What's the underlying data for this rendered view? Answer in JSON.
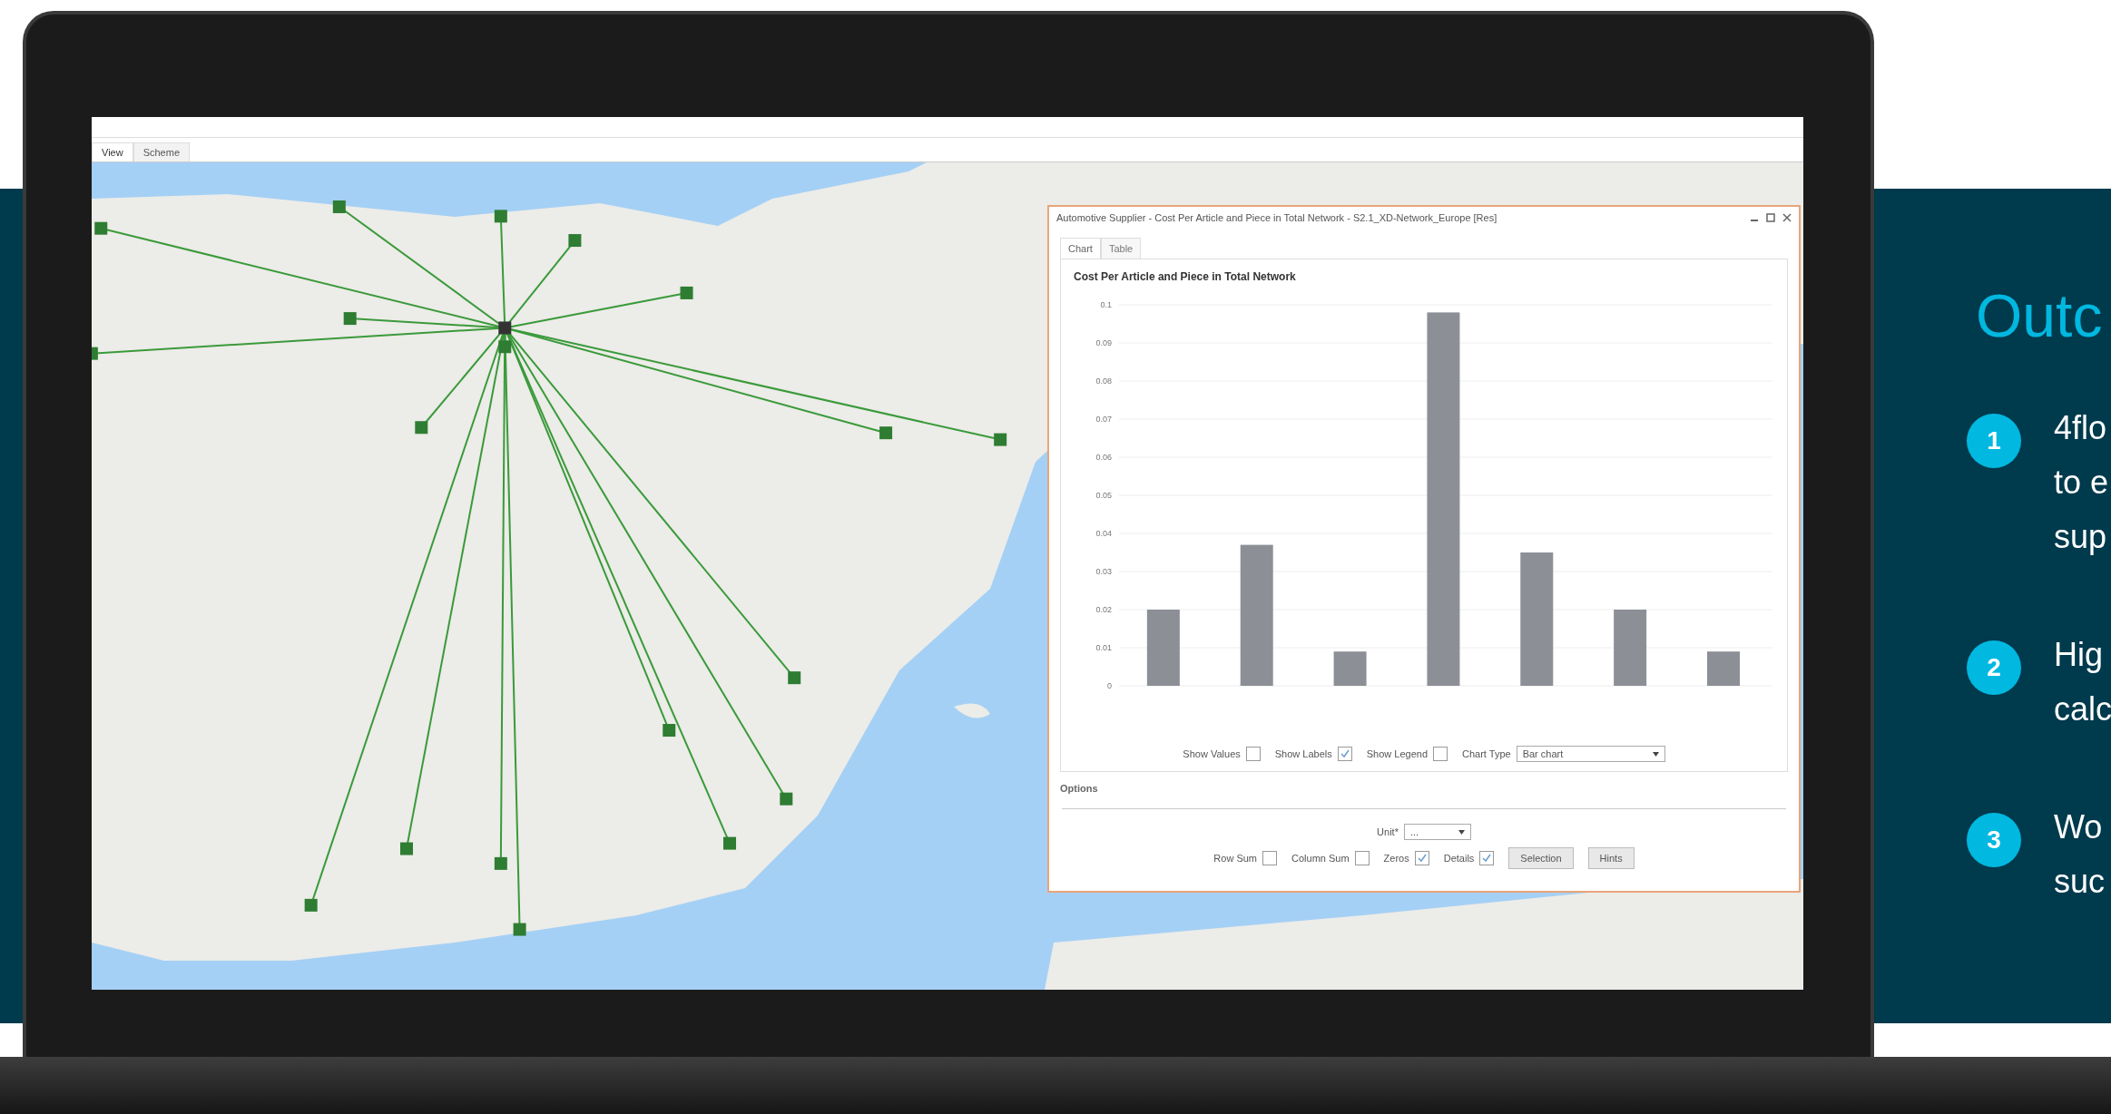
{
  "app": {
    "tabs": [
      {
        "label": "View",
        "selected": true
      },
      {
        "label": "Scheme",
        "selected": false
      }
    ]
  },
  "chart_window": {
    "title": "Automotive Supplier - Cost Per Article and Piece in Total Network - S2.1_XD-Network_Europe [Res]",
    "tabs": [
      {
        "label": "Chart",
        "selected": true
      },
      {
        "label": "Table",
        "selected": false
      }
    ],
    "chart_data": {
      "type": "bar",
      "title": "Cost Per Article and Piece in Total Network",
      "values": [
        0.02,
        0.037,
        0.009,
        0.098,
        0.035,
        0.02,
        0.009
      ],
      "ylim": [
        0,
        0.1
      ],
      "grid": true,
      "yticks": [
        0,
        0.01,
        0.02,
        0.03,
        0.04,
        0.05,
        0.06,
        0.07,
        0.08,
        0.09,
        0.1
      ]
    },
    "chart_options": [
      {
        "label": "Show Values",
        "checked": false
      },
      {
        "label": "Show Labels",
        "checked": true
      },
      {
        "label": "Show Legend",
        "checked": false
      }
    ],
    "chart_type": {
      "label": "Chart Type",
      "value": "Bar chart"
    },
    "options_title": "Options",
    "unit": {
      "label": "Unit*",
      "value": "..."
    },
    "table_options": [
      {
        "label": "Row Sum",
        "checked": false
      },
      {
        "label": "Column Sum",
        "checked": false
      },
      {
        "label": "Zeros",
        "checked": true
      },
      {
        "label": "Details",
        "checked": true
      }
    ],
    "buttons": [
      "Selection",
      "Hints"
    ]
  },
  "outcomes": {
    "heading": "Outc",
    "items": [
      {
        "number": "1",
        "lines": [
          "4flo",
          "to e",
          "sup"
        ]
      },
      {
        "number": "2",
        "lines": [
          "Hig",
          "calc"
        ]
      },
      {
        "number": "3",
        "lines": [
          "Wo",
          "suc"
        ]
      }
    ]
  }
}
